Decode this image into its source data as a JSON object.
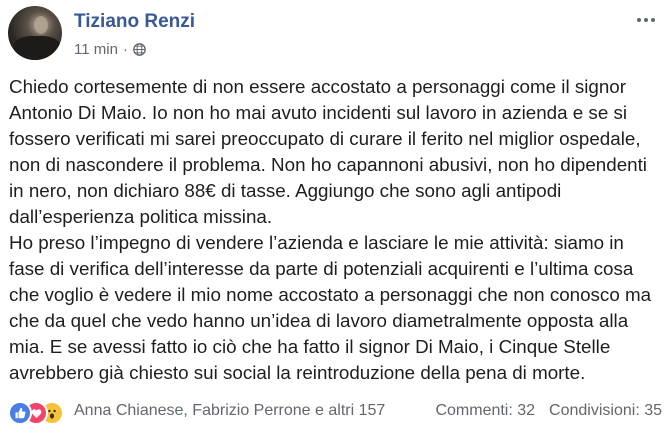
{
  "post": {
    "author": "Tiziano Renzi",
    "timestamp": "11 min",
    "separator": "·",
    "privacy_icon": "globe-icon",
    "more_icon": "more-horizontal-icon",
    "paragraphs": [
      "Chiedo cortesemente di non essere accostato a personaggi come il signor Antonio Di Maio. Io non ho mai avuto incidenti sul lavoro in azienda e se si fossero verificati mi sarei preoccupato di curare il ferito nel miglior ospedale, non di nascondere il problema. Non ho capannoni abusivi, non ho dipendenti in nero, non dichiaro 88€ di tasse. Aggiungo che sono agli antipodi dall’esperienza politica missina.",
      "Ho preso l’impegno di vendere l’azienda e lasciare le mie attività: siamo in fase di verifica dell’interesse da parte di potenziali acquirenti e l’ultima cosa che voglio è vedere il mio nome accostato a personaggi che non conosco ma che da quel che vedo hanno un’idea di lavoro diametralmente opposta alla mia. E se avessi fatto io ciò che ha fatto il signor Di Maio, i Cinque Stelle avrebbero già chiesto sui social la reintroduzione della pena di morte."
    ]
  },
  "footer": {
    "reaction_icons": [
      "like-icon",
      "love-icon",
      "wow-icon"
    ],
    "reactors": "Anna Chianese, Fabrizio Perrone e altri 157",
    "comments": "Commenti: 32",
    "shares": "Condivisioni: 35"
  },
  "colors": {
    "author_link": "#385898",
    "meta_text": "#616770",
    "like": "#4a7de5",
    "love": "#f2446a",
    "wow": "#f7c23b"
  }
}
